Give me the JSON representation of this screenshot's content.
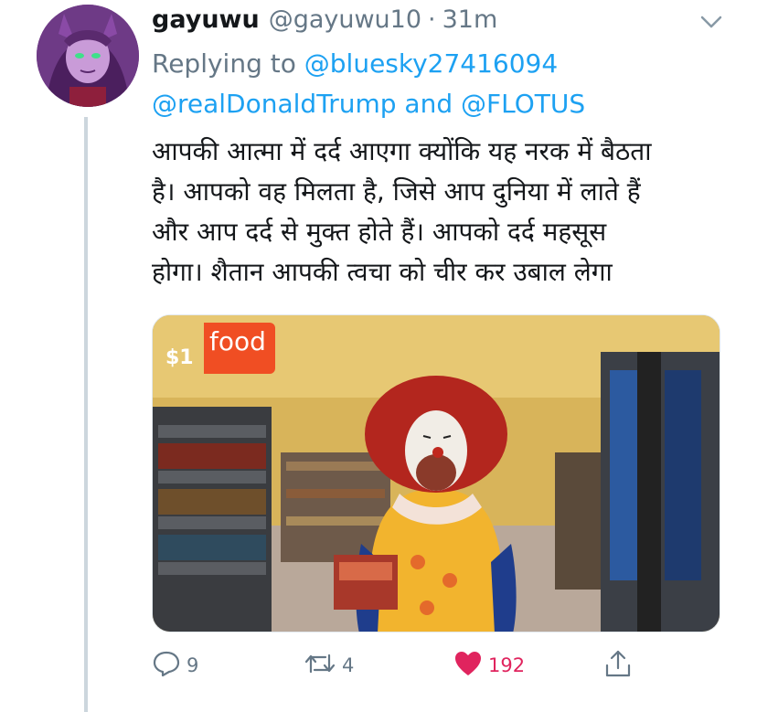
{
  "tweet": {
    "display_name": "gayuwu",
    "handle": "@gayuwu10",
    "separator": "·",
    "time": "31m",
    "replying_to_label": "Replying to",
    "reply_mentions": [
      "@bluesky27416094",
      "@realDonaldTrump",
      "@FLOTUS"
    ],
    "and_word": "and",
    "text_lines": [
      "आपकी आत्मा में दर्द आएगा क्योंकि यह नरक में बैठता",
      "है।  आपको वह मिलता है, जिसे आप दुनिया में लाते हैं",
      "और आप दर्द से मुक्त होते हैं।  आपको दर्द महसूस",
      "होगा।  शैतान आपकी त्वचा को चीर कर उबाल लेगा"
    ],
    "media": {
      "sign_text": "food",
      "price_text": "$1"
    },
    "actions": {
      "reply_count": "9",
      "retweet_count": "4",
      "like_count": "192",
      "like_color": "#e0245e"
    }
  },
  "colors": {
    "accent": "#1da1f2",
    "secondary_text": "#657786",
    "thread_line": "#ccd6dd"
  }
}
